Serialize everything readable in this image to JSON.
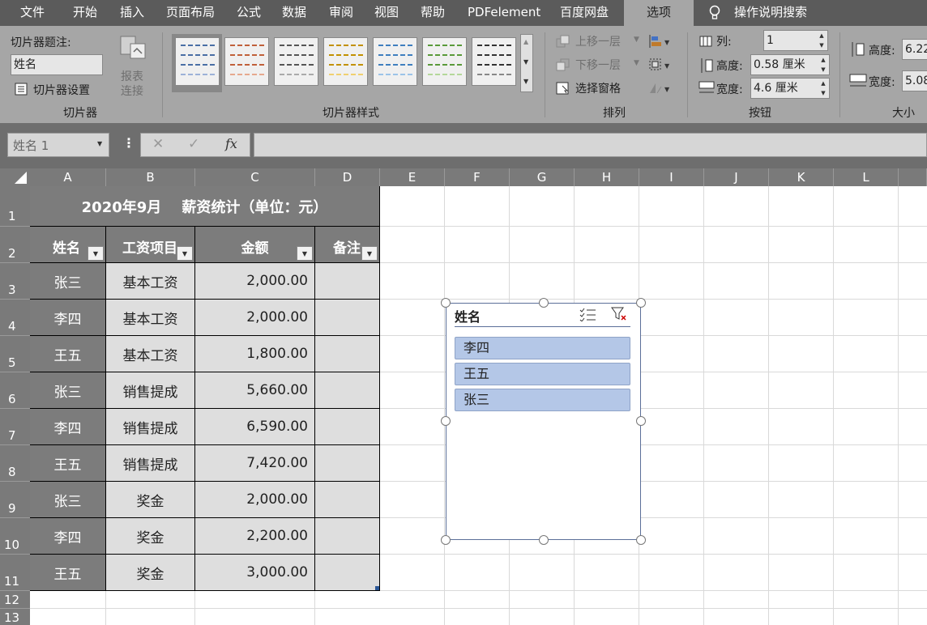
{
  "tabs": [
    "文件",
    "开始",
    "插入",
    "页面布局",
    "公式",
    "数据",
    "审阅",
    "视图",
    "帮助",
    "PDFelement",
    "百度网盘",
    "选项",
    "操作说明搜索"
  ],
  "ribbon": {
    "slicer_group": {
      "caption_label": "切片器题注:",
      "caption_value": "姓名",
      "settings_label": "切片器设置",
      "report_label_1": "报表",
      "report_label_2": "连接",
      "group_name": "切片器"
    },
    "styles_group": {
      "group_name": "切片器样式"
    },
    "arrange_group": {
      "bring_forward": "上移一层",
      "send_backward": "下移一层",
      "selection_pane": "选择窗格",
      "group_name": "排列"
    },
    "buttons_group": {
      "columns_label": "列:",
      "columns_value": "1",
      "height_label": "高度:",
      "height_value": "0.58 厘米",
      "width_label": "宽度:",
      "width_value": "4.6 厘米",
      "group_name": "按钮"
    },
    "size_group": {
      "height_label": "高度:",
      "height_value": "6.22",
      "width_label": "宽度:",
      "width_value": "5.08",
      "group_name": "大小"
    }
  },
  "formula_bar": {
    "name_box": "姓名 1",
    "cancel_symbol": "✕",
    "enter_symbol": "✓",
    "fx_label": "fx"
  },
  "columns": [
    "A",
    "B",
    "C",
    "D",
    "E",
    "F",
    "G",
    "H",
    "I",
    "J",
    "K",
    "L"
  ],
  "rows": [
    "1",
    "2",
    "3",
    "4",
    "5",
    "6",
    "7",
    "8",
    "9",
    "10",
    "11",
    "12",
    "13"
  ],
  "table": {
    "title": "2020年9月    薪资统计（单位：元）",
    "headers": [
      "姓名",
      "工资项目",
      "金额",
      "备注"
    ],
    "rows": [
      {
        "name": "张三",
        "item": "基本工资",
        "amount": "2,000.00",
        "note": ""
      },
      {
        "name": "李四",
        "item": "基本工资",
        "amount": "2,000.00",
        "note": ""
      },
      {
        "name": "王五",
        "item": "基本工资",
        "amount": "1,800.00",
        "note": ""
      },
      {
        "name": "张三",
        "item": "销售提成",
        "amount": "5,660.00",
        "note": ""
      },
      {
        "name": "李四",
        "item": "销售提成",
        "amount": "6,590.00",
        "note": ""
      },
      {
        "name": "王五",
        "item": "销售提成",
        "amount": "7,420.00",
        "note": ""
      },
      {
        "name": "张三",
        "item": "奖金",
        "amount": "2,000.00",
        "note": ""
      },
      {
        "name": "李四",
        "item": "奖金",
        "amount": "2,200.00",
        "note": ""
      },
      {
        "name": "王五",
        "item": "奖金",
        "amount": "3,000.00",
        "note": ""
      }
    ]
  },
  "slicer": {
    "title": "姓名",
    "items": [
      "李四",
      "王五",
      "张三"
    ]
  }
}
